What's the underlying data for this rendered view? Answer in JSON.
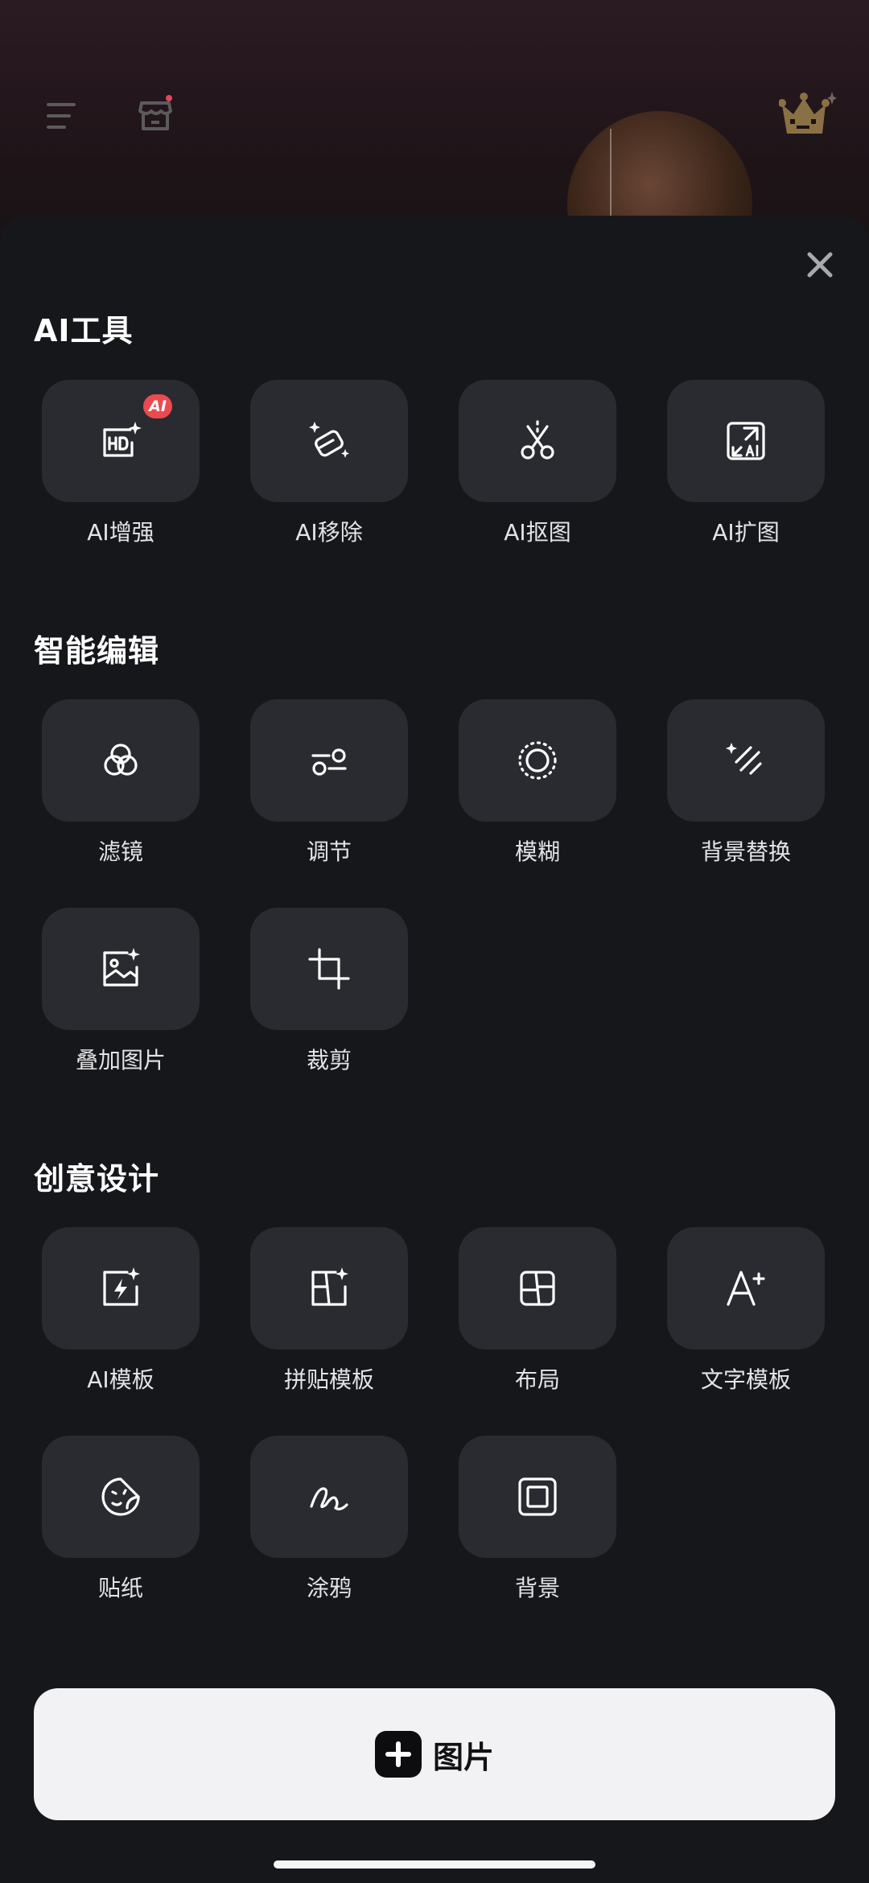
{
  "sections": [
    {
      "title": "AI工具",
      "items": [
        {
          "label": "AI增强",
          "icon": "hd-enhance-icon",
          "badge": "AI"
        },
        {
          "label": "AI移除",
          "icon": "eraser-icon"
        },
        {
          "label": "AI抠图",
          "icon": "scissors-icon"
        },
        {
          "label": "AI扩图",
          "icon": "expand-icon"
        }
      ]
    },
    {
      "title": "智能编辑",
      "items": [
        {
          "label": "滤镜",
          "icon": "filter-icon"
        },
        {
          "label": "调节",
          "icon": "adjust-icon"
        },
        {
          "label": "模糊",
          "icon": "blur-icon"
        },
        {
          "label": "背景替换",
          "icon": "background-replace-icon"
        },
        {
          "label": "叠加图片",
          "icon": "overlay-image-icon"
        },
        {
          "label": "裁剪",
          "icon": "crop-icon"
        }
      ]
    },
    {
      "title": "创意设计",
      "items": [
        {
          "label": "AI模板",
          "icon": "ai-template-icon"
        },
        {
          "label": "拼贴模板",
          "icon": "collage-template-icon"
        },
        {
          "label": "布局",
          "icon": "layout-icon"
        },
        {
          "label": "文字模板",
          "icon": "text-template-icon"
        },
        {
          "label": "贴纸",
          "icon": "sticker-icon"
        },
        {
          "label": "涂鸦",
          "icon": "doodle-icon"
        },
        {
          "label": "背景",
          "icon": "background-icon"
        }
      ]
    }
  ],
  "add_button": {
    "label": "图片",
    "icon": "plus-icon"
  },
  "top_bar": {
    "menu_icon": "menu-icon",
    "store_icon": "store-icon",
    "premium_icon": "crown-icon",
    "close_icon": "close-icon"
  },
  "colors": {
    "sheet_bg": "#16171b",
    "tile_bg": "#2a2b30",
    "badge": "#ec4a4f",
    "button_bg": "#f2f2f4",
    "crown": "#8a7045"
  }
}
